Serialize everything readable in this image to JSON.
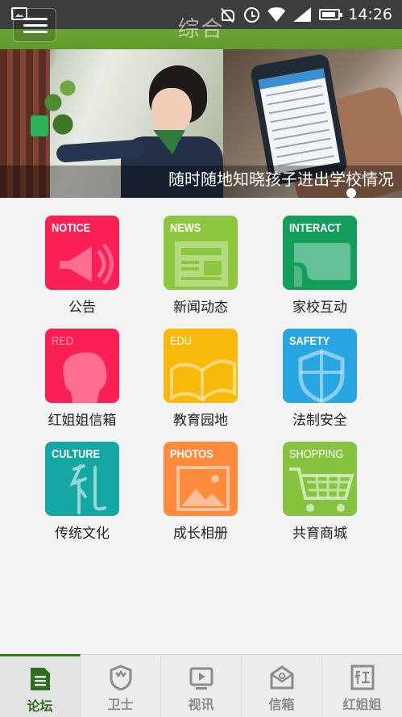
{
  "status_bar": {
    "time": "14:26"
  },
  "header": {
    "title": "综合"
  },
  "banner": {
    "caption": "随时随地知晓孩子进出学校情况",
    "pages": 1,
    "active_page": 1
  },
  "tiles": [
    {
      "tag": "NOTICE",
      "label": "公告",
      "color": "#fa1f55",
      "icon": "megaphone-icon"
    },
    {
      "tag": "NEWS",
      "label": "新闻动态",
      "color": "#8dc63f",
      "icon": "newspaper-icon"
    },
    {
      "tag": "INTERACT",
      "label": "家校互动",
      "color": "#149e5c",
      "icon": "chat-icon"
    },
    {
      "tag": "RED",
      "label": "红姐姐信箱",
      "color": "#fa1f55",
      "icon": "girl-silhouette-icon"
    },
    {
      "tag": "EDU",
      "label": "教育园地",
      "color": "#f9b90a",
      "icon": "book-icon"
    },
    {
      "tag": "SAFETY",
      "label": "法制安全",
      "color": "#28a5e3",
      "icon": "shield-icon"
    },
    {
      "tag": "CULTURE",
      "label": "传统文化",
      "color": "#14a7a3",
      "icon": "calligraphy-icon"
    },
    {
      "tag": "PHOTOS",
      "label": "成长相册",
      "color": "#ff8a3c",
      "icon": "photo-icon"
    },
    {
      "tag": "SHOPPING",
      "label": "共育商城",
      "color": "#86c440",
      "icon": "cart-icon"
    }
  ],
  "bottom_nav": [
    {
      "label": "论坛",
      "icon": "forum-icon",
      "active": true
    },
    {
      "label": "卫士",
      "icon": "guard-shield-icon",
      "active": false
    },
    {
      "label": "视讯",
      "icon": "video-icon",
      "active": false
    },
    {
      "label": "信箱",
      "icon": "mailbox-icon",
      "active": false
    },
    {
      "label": "红姐姐",
      "icon": "red-sister-icon",
      "active": false
    }
  ]
}
